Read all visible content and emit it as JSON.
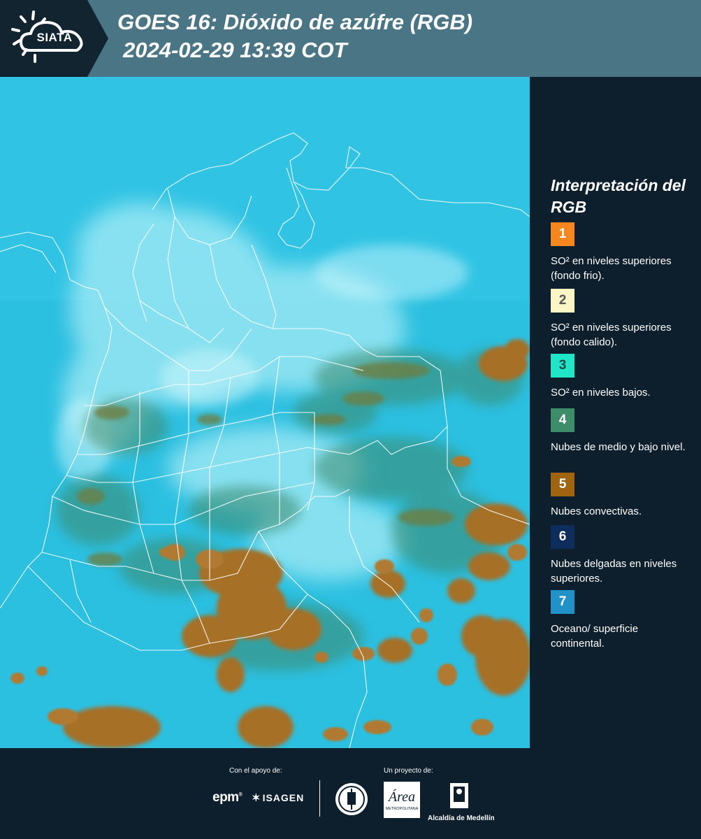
{
  "header": {
    "logo_text": "SIATA",
    "title_line1": "GOES 16: Dióxido de azúfre (RGB)",
    "title_line2": "2024-02-29 13:39 COT",
    "background_color": "#4a7585"
  },
  "map": {
    "colors": {
      "ocean_surface": "#2bbfe0",
      "haze": "#b8f2f8",
      "convective": "#a66f28",
      "mid_low": "#3d8a6c",
      "borders": "#ffffff"
    }
  },
  "legend": {
    "title": "Interpretación del RGB",
    "items": [
      {
        "number": "1",
        "color": "#f7861e",
        "text_color": "#ffffff",
        "label": "SO² en niveles superiores (fondo frio)."
      },
      {
        "number": "2",
        "color": "#fcf6c6",
        "text_color": "#555555",
        "label": "SO² en niveles superiores (fondo calido)."
      },
      {
        "number": "3",
        "color": "#1ee6c6",
        "text_color": "#1d4b4b",
        "label": "SO² en niveles bajos."
      },
      {
        "number": "4",
        "color": "#3d8c6a",
        "text_color": "#ffffff",
        "label": "Nubes de medio y bajo nivel."
      },
      {
        "number": "5",
        "color": "#a0640e",
        "text_color": "#ffffff",
        "label": "Nubes convectivas."
      },
      {
        "number": "6",
        "color": "#0e2c5c",
        "text_color": "#ffffff",
        "label": "Nubes delgadas en niveles superiores."
      },
      {
        "number": "7",
        "color": "#2192c8",
        "text_color": "#ffffff",
        "label": "Oceano/ superficie continental."
      }
    ]
  },
  "footer": {
    "support_label": "Con el apoyo de:",
    "project_label": "Un proyecto de:",
    "epm_logo_text": "epm",
    "isagen_logo_text": "ISAGEN",
    "area_logo_text": "Área",
    "area_subtext": "METROPOLITANA",
    "alcaldia_text": "Alcaldía de Medellín"
  }
}
